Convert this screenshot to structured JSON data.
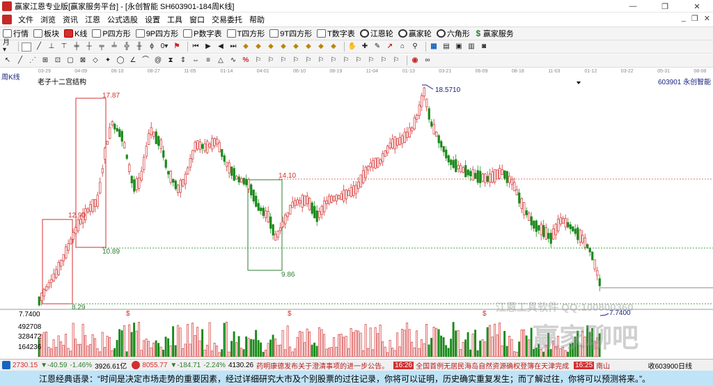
{
  "window": {
    "title": "赢家江恩专业版[赢家服务平台] - [永创智能  SH603901-184周K线]",
    "controls": {
      "minimize": "—",
      "restore": "❐",
      "close": "✕"
    },
    "mdi_controls": {
      "minimize": "_",
      "restore": "❐",
      "close": "✕"
    }
  },
  "menu": [
    "文件",
    "浏览",
    "资讯",
    "江恩",
    "公式选股",
    "设置",
    "工具",
    "窗口",
    "交易委托",
    "帮助"
  ],
  "toolbar1": [
    "行情",
    "板块",
    "K线",
    "P四方形",
    "9P四方形",
    "P数字表",
    "T四方形",
    "9T四方形",
    "T数字表",
    "江恩轮",
    "赢家轮",
    "六角形",
    "赢家服务"
  ],
  "toolbar2_icons": [
    "period-dropdown-icon",
    "grid-icon",
    "line-draw-icon",
    "segment-icon",
    "ray-icon",
    "channel-icon",
    "fan-icon",
    "arc-icon",
    "flag-icon",
    "play-start-icon",
    "play-back-icon",
    "play-icon",
    "play-fwd-icon",
    "diamond-icon",
    "hand-icon",
    "cross-icon",
    "zoom-icon",
    "calc-icon",
    "chart-icon",
    "save-icon",
    "grid2-icon",
    "camera-icon"
  ],
  "toolbar3_icons": [
    "cursor-icon",
    "gann-angle-icon",
    "gann-fan-icon",
    "box-icon",
    "square-icon",
    "circle-icon",
    "time-cycle-icon",
    "fib-icon",
    "percent-icon",
    "infinity-icon"
  ],
  "chart": {
    "period_label": "周K线",
    "indicator_label": "老子十二宫结构",
    "stock_label": "603901 永创智能",
    "date_ticks": [
      "03-29",
      "04-09",
      "06-10",
      "08-27",
      "11-05",
      "01-14",
      "04-01",
      "06-10",
      "08-19",
      "11-04",
      "01-13",
      "03-21",
      "06-09",
      "08-18",
      "11-03",
      "01-12",
      "03-22",
      "05-31",
      "08-08"
    ],
    "price_labels": {
      "top_left": "17.87",
      "mid_left": "12.90",
      "lower_left": "10.89",
      "bottom_left": "8.29",
      "mid_center": "14.10",
      "low_center": "9.86",
      "high_right": "18.5710",
      "last_low": "7.7400",
      "axis_min": "7.7400"
    },
    "volume_labels": [
      "492708",
      "328472",
      "164236"
    ],
    "dollar_marks": [
      "$",
      "$",
      "$"
    ],
    "colors": {
      "up": "#d32f2f",
      "down": "#1b8a1b",
      "blue": "#1a237e",
      "bg": "#ffffff"
    }
  },
  "watermark": {
    "line1": "江恩工具软件  QQ:100800360",
    "line2": "赢家聊吧"
  },
  "status": {
    "sh_index": "2730.15",
    "sh_change": "▼-40.59",
    "sh_pct": "-1.46%",
    "sh_vol": "3926.61亿",
    "sz_index": "8055.77",
    "sz_change": "▼-184.71",
    "sz_pct": "-2.24%",
    "sz_vol": "4130.26",
    "news1": "药明康德发布关于澄清事项的进一步公告。",
    "news_time1": "16:26",
    "news2": "全国首例无居民海岛自然资源确权登簿在天津完成",
    "news_time2": "16:25",
    "news3": "南山",
    "right": "收603900日线"
  },
  "quote": "江恩经典语录：“时间是决定市场走势的重要因素，经过详细研究大市及个别股票的过往记录，你将可以证明，历史确实重复发生；而了解过往，你将可以预测将来。”。"
}
